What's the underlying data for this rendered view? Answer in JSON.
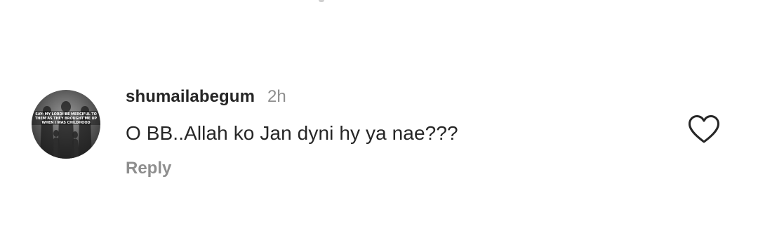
{
  "comment": {
    "avatar_caption": "SAY: MY LORD! BE MERCIFUL TO THEM AS THEY BROUGHT ME UP WHEN I WAS CHILDHOOD",
    "username": "shumailabegum",
    "timestamp": "2h",
    "text": "O BB..Allah ko Jan dyni hy ya nae???",
    "reply_label": "Reply",
    "like_icon": "heart-outline-icon"
  }
}
